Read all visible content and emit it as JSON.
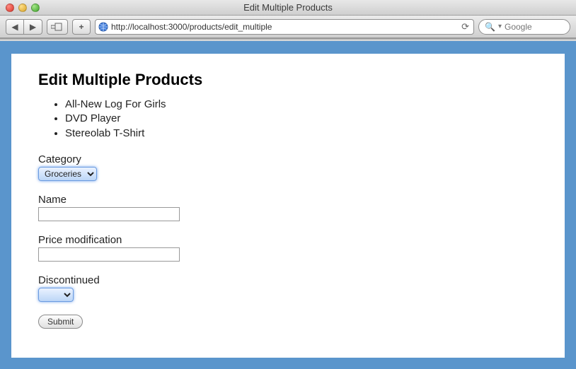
{
  "window": {
    "title": "Edit Multiple Products",
    "url": "http://localhost:3000/products/edit_multiple",
    "search_placeholder": "Google"
  },
  "page": {
    "heading": "Edit Multiple Products",
    "products": [
      "All-New Log For Girls",
      "DVD Player",
      "Stereolab T-Shirt"
    ],
    "form": {
      "category": {
        "label": "Category",
        "selected": "Groceries"
      },
      "name": {
        "label": "Name",
        "value": ""
      },
      "price_mod": {
        "label": "Price modification",
        "value": ""
      },
      "discontinued": {
        "label": "Discontinued",
        "selected": ""
      },
      "submit_label": "Submit"
    }
  }
}
